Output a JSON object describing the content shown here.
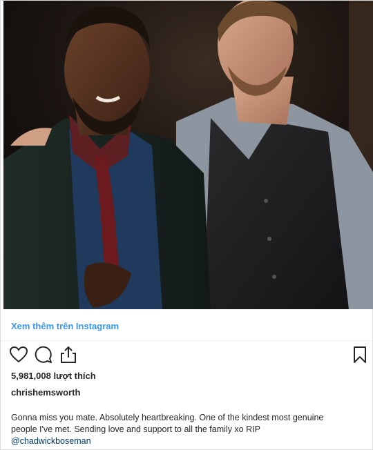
{
  "post": {
    "image_alt": "",
    "view_more_label": "Xem thêm trên Instagram",
    "icons": {
      "like": "heart-icon",
      "comment": "comment-icon",
      "share": "share-icon",
      "save": "bookmark-icon"
    },
    "likes_text": "5,981,008 lượt thích",
    "username": "chrishemsworth",
    "caption_line_1": "Gonna miss you mate. Absolutely heartbreaking. One of the kindest most genuine",
    "caption_line_2": "people I've met. Sending love and support to all the family xo RIP",
    "mention": "@chadwickboseman",
    "colors": {
      "link": "#3897f0",
      "mention": "#00376b",
      "text": "#262626",
      "border": "#dbdbdb"
    }
  }
}
